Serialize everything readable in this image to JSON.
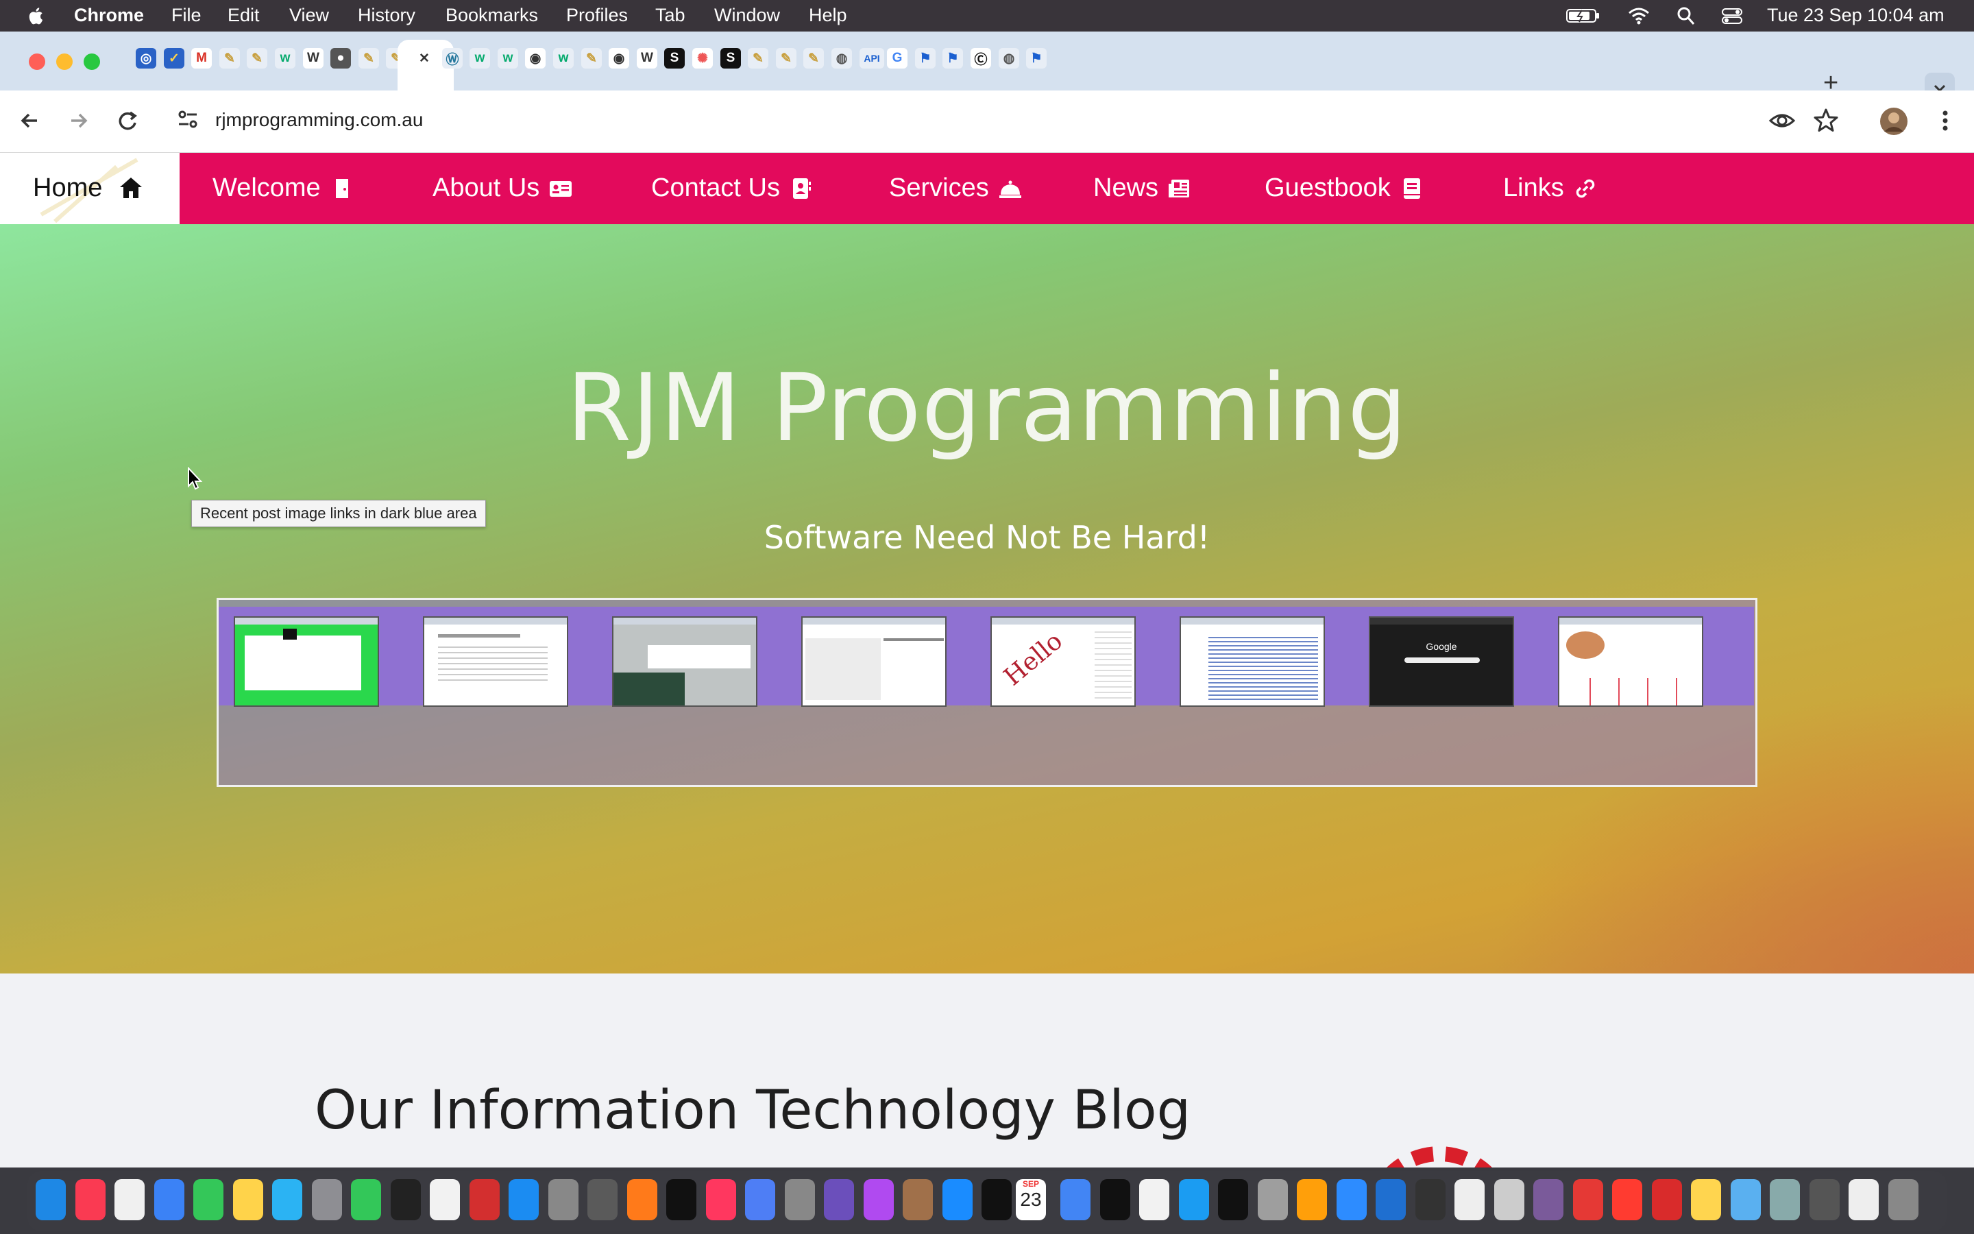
{
  "menubar": {
    "app_name": "Chrome",
    "items": [
      "File",
      "Edit",
      "View",
      "History",
      "Bookmarks",
      "Profiles",
      "Tab",
      "Window",
      "Help"
    ],
    "clock": "Tue 23 Sep  10:04 am"
  },
  "browser": {
    "url": "rjmprogramming.com.au",
    "tab_favicons": [
      "compass",
      "check-circle",
      "gmail",
      "feather",
      "feather",
      "w3",
      "wikipedia",
      "github",
      "feather",
      "feather",
      "close",
      "wordpress",
      "w3",
      "w3",
      "chrome",
      "w3",
      "feather",
      "chrome",
      "wikipedia",
      "s-app",
      "photos",
      "s-app",
      "feather",
      "feather",
      "feather",
      "globe",
      "api",
      "google",
      "flag",
      "flag",
      "cc",
      "globe",
      "flag"
    ],
    "api_tab_label": "API"
  },
  "site": {
    "nav": [
      {
        "label": "Home",
        "icon": "home-icon"
      },
      {
        "label": "Welcome",
        "icon": "door-icon"
      },
      {
        "label": "About Us",
        "icon": "id-card-icon"
      },
      {
        "label": "Contact Us",
        "icon": "address-book-icon"
      },
      {
        "label": "Services",
        "icon": "bell-icon"
      },
      {
        "label": "News",
        "icon": "newspaper-icon"
      },
      {
        "label": "Guestbook",
        "icon": "book-icon"
      },
      {
        "label": "Links",
        "icon": "link-icon"
      }
    ],
    "hero_title": "RJM Programming",
    "hero_subtitle": "Software Need Not Be Hard!",
    "tooltip": "Recent post image links in dark blue area",
    "thumbnails_count": 8,
    "thumb_google_text": "Google",
    "thumb_hello_text": "Hello",
    "blog_heading": "Our Information Technology Blog"
  },
  "dock": {
    "calendar_month": "SEP",
    "calendar_day": "23"
  },
  "colors": {
    "nav_bg": "#e30a5c",
    "tab_strip": "#d5e1ef",
    "post_strip": "#8f71d2"
  }
}
